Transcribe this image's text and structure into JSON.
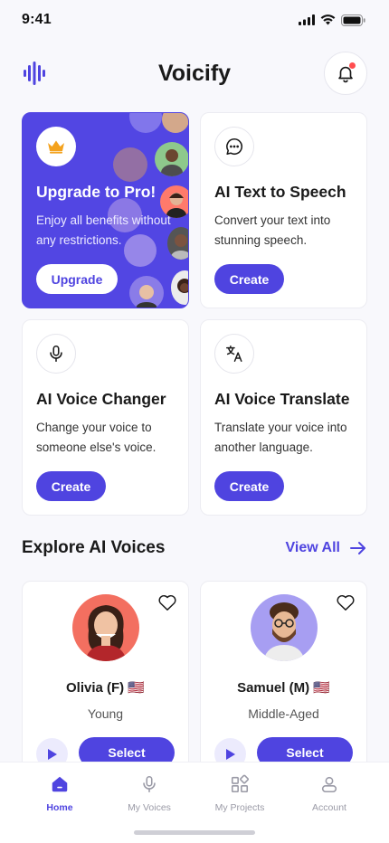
{
  "status": {
    "time": "9:41"
  },
  "header": {
    "title": "Voicify"
  },
  "colors": {
    "accent": "#4f44e0",
    "pro_bg": "#5246e3",
    "crown": "#f4a21d"
  },
  "cards": {
    "pro": {
      "title": "Upgrade to Pro!",
      "desc": "Enjoy all benefits without any restrictions.",
      "button": "Upgrade"
    },
    "tts": {
      "title": "AI Text to Speech",
      "desc": "Convert your text into stunning speech.",
      "button": "Create"
    },
    "changer": {
      "title": "AI Voice Changer",
      "desc": "Change your voice to someone else's voice.",
      "button": "Create"
    },
    "translate": {
      "title": "AI Voice Translate",
      "desc": "Translate your voice into another language.",
      "button": "Create"
    }
  },
  "explore": {
    "title": "Explore AI Voices",
    "view_all": "View All"
  },
  "voices": [
    {
      "name": "Olivia (F) 🇺🇸",
      "age": "Young",
      "button": "Select"
    },
    {
      "name": "Samuel (M) 🇺🇸",
      "age": "Middle-Aged",
      "button": "Select"
    }
  ],
  "tabs": [
    {
      "label": "Home"
    },
    {
      "label": "My Voices"
    },
    {
      "label": "My Projects"
    },
    {
      "label": "Account"
    }
  ]
}
